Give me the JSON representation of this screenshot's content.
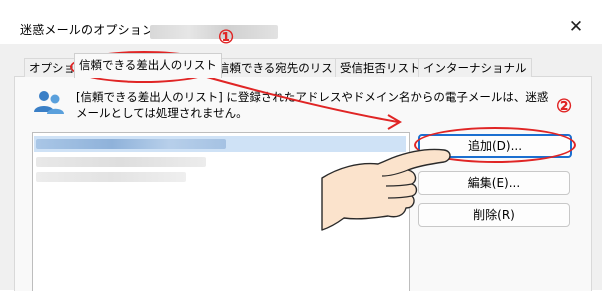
{
  "window": {
    "title": "迷惑メールのオプション -",
    "close_glyph": "✕"
  },
  "tabs": [
    {
      "label": "オプション"
    },
    {
      "label": "信頼できる差出人のリスト",
      "active": true
    },
    {
      "label": "信頼できる宛先のリスト"
    },
    {
      "label": "受信拒否リスト"
    },
    {
      "label": "インターナショナル"
    }
  ],
  "message": {
    "line1": "[信頼できる差出人のリスト] に登録されたアドレスやドメイン名からの電子メールは、迷惑",
    "line2": "メールとしては処理されません。",
    "icon": "people-icon"
  },
  "buttons": {
    "add": "追加(D)...",
    "edit": "編集(E)...",
    "delete": "削除(R)"
  },
  "annotations": {
    "step1": "①",
    "step2": "②",
    "color": "#e02525"
  },
  "colors": {
    "accent": "#1b6fd0",
    "selection": "#cfe2f6",
    "annotation": "#e02525"
  }
}
